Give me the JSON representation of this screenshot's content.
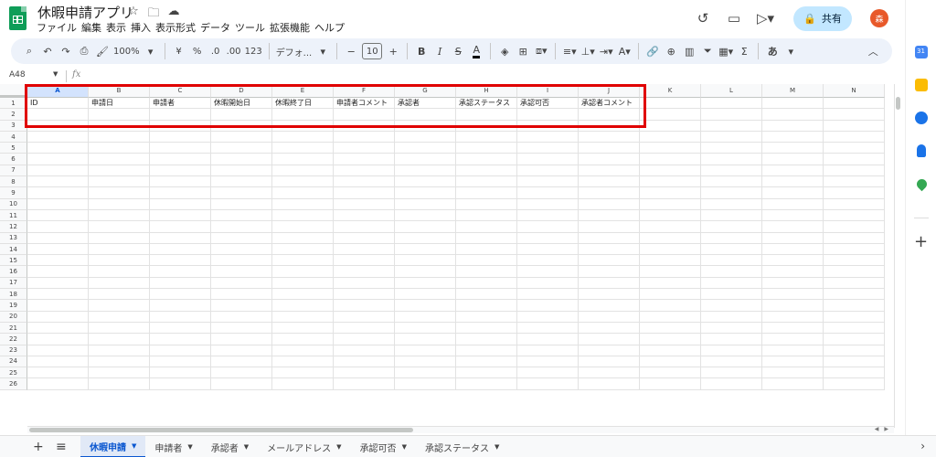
{
  "app": {
    "doc_title": "休暇申請アプリ",
    "menu": [
      "ファイル",
      "編集",
      "表示",
      "挿入",
      "表示形式",
      "データ",
      "ツール",
      "拡張機能",
      "ヘルプ"
    ],
    "share_label": "共有",
    "avatar_initial": "森"
  },
  "toolbar": {
    "zoom": "100%",
    "currency": "¥",
    "percent": "%",
    "dec_decrease": ".0",
    "dec_increase": ".00",
    "number_format": "123",
    "font": "デフォ...",
    "font_size": "10",
    "bold": "B",
    "italic": "I",
    "strike": "S",
    "text_color": "A",
    "input_tools": "あ"
  },
  "formula_bar": {
    "name_box": "A48",
    "fx": "fx"
  },
  "grid": {
    "columns": [
      "A",
      "B",
      "C",
      "D",
      "E",
      "F",
      "G",
      "H",
      "I",
      "J",
      "K",
      "L",
      "M",
      "N"
    ],
    "rows": [
      "1",
      "2",
      "3",
      "4",
      "5",
      "6",
      "7",
      "8",
      "9",
      "10",
      "11",
      "12",
      "13",
      "14",
      "15",
      "16",
      "17",
      "18",
      "19",
      "20",
      "21",
      "22",
      "23",
      "24",
      "25",
      "26"
    ],
    "header_row": [
      "ID",
      "申請日",
      "申請者",
      "休暇開始日",
      "休暇終了日",
      "申請者コメント",
      "承認者",
      "承認ステータス",
      "承認可否",
      "承認者コメント",
      "",
      "",
      "",
      ""
    ]
  },
  "sheet_tabs": [
    "休暇申請",
    "申請者",
    "承認者",
    "メールアドレス",
    "承認可否",
    "承認ステータス"
  ],
  "colors": {
    "accent": "#0b57d0",
    "highlight_box": "#e00000",
    "share_bg": "#c2e7ff",
    "sheets_green": "#0f9d58"
  }
}
